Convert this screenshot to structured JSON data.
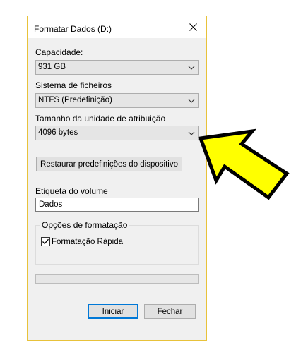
{
  "window": {
    "title": "Formatar Dados (D:)"
  },
  "capacity": {
    "label": "Capacidade:",
    "value": "931 GB"
  },
  "filesystem": {
    "label": "Sistema de ficheiros",
    "value": "NTFS (Predefinição)"
  },
  "allocation": {
    "label": "Tamanho da unidade de atribuição",
    "value": "4096 bytes"
  },
  "restore_button": "Restaurar predefinições do dispositivo",
  "volume": {
    "label": "Etiqueta do volume",
    "value": "Dados"
  },
  "format_options": {
    "legend": "Opções de formatação",
    "quick_format": {
      "label": "Formatação Rápida",
      "checked": true
    }
  },
  "progress": {
    "value": 0
  },
  "buttons": {
    "start": "Iniciar",
    "close": "Fechar"
  },
  "annotation": {
    "arrow_color": "#ffff00",
    "arrow_outline": "#000000"
  }
}
